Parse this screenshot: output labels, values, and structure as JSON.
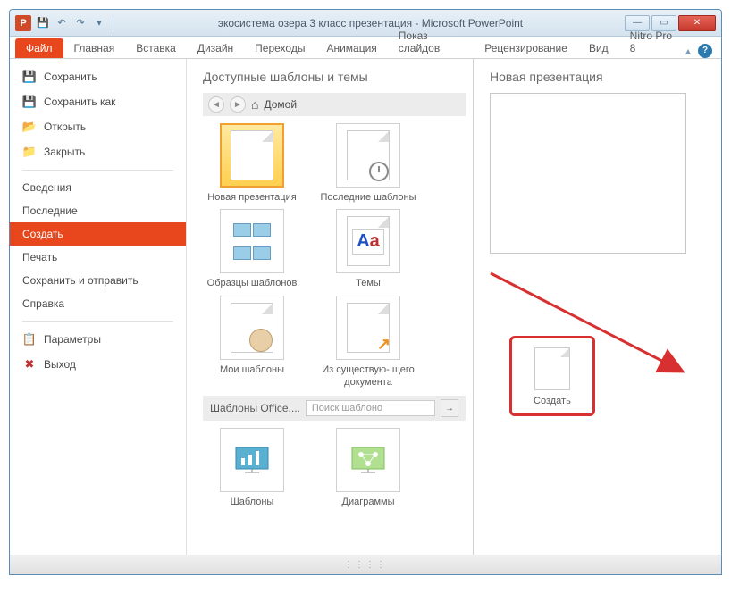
{
  "window": {
    "title": "экосистема озера 3 класс презентация  -  Microsoft PowerPoint"
  },
  "ribbon": {
    "tabs": {
      "file": "Файл",
      "home": "Главная",
      "insert": "Вставка",
      "design": "Дизайн",
      "transitions": "Переходы",
      "animation": "Анимация",
      "slideshow": "Показ слайдов",
      "review": "Рецензирование",
      "view": "Вид",
      "nitro": "Nitro Pro 8"
    }
  },
  "sidebar": {
    "save": "Сохранить",
    "saveas": "Сохранить как",
    "open": "Открыть",
    "close": "Закрыть",
    "info": "Сведения",
    "recent": "Последние",
    "new": "Создать",
    "print": "Печать",
    "share": "Сохранить и отправить",
    "help": "Справка",
    "options": "Параметры",
    "exit": "Выход"
  },
  "templates": {
    "heading": "Доступные шаблоны и темы",
    "home": "Домой",
    "items": {
      "blank": "Новая презентация",
      "recent": "Последние шаблоны",
      "samples": "Образцы шаблонов",
      "themes": "Темы",
      "my": "Мои шаблоны",
      "existing": "Из существую- щего документа",
      "charts": "Шаблоны",
      "diagrams": "Диаграммы"
    },
    "office_section": "Шаблоны Office....",
    "search_placeholder": "Поиск шаблоно"
  },
  "preview": {
    "heading": "Новая презентация",
    "create": "Создать"
  }
}
